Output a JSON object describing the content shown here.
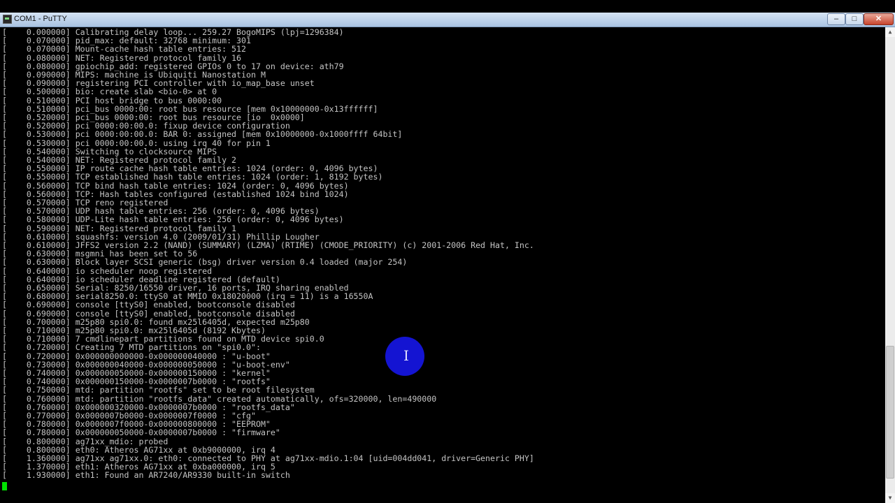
{
  "window": {
    "title": "COM1 - PuTTY",
    "buttons": {
      "minimize": "–",
      "maximize": "□",
      "close": "✕"
    },
    "icon": "putty-terminal-icon"
  },
  "terminal": {
    "lines": [
      "[    0.000000] Calibrating delay loop... 259.27 BogoMIPS (lpj=1296384)",
      "[    0.070000] pid_max: default: 32768 minimum: 301",
      "[    0.070000] Mount-cache hash table entries: 512",
      "[    0.080000] NET: Registered protocol family 16",
      "[    0.080000] gpiochip_add: registered GPIOs 0 to 17 on device: ath79",
      "[    0.090000] MIPS: machine is Ubiquiti Nanostation M",
      "[    0.090000] registering PCI controller with io_map_base unset",
      "[    0.500000] bio: create slab <bio-0> at 0",
      "[    0.510000] PCI host bridge to bus 0000:00",
      "[    0.510000] pci_bus 0000:00: root bus resource [mem 0x10000000-0x13ffffff]",
      "[    0.520000] pci_bus 0000:00: root bus resource [io  0x0000]",
      "[    0.520000] pci 0000:00:00.0: fixup device configuration",
      "[    0.530000] pci 0000:00:00.0: BAR 0: assigned [mem 0x10000000-0x1000ffff 64bit]",
      "[    0.530000] pci 0000:00:00.0: using irq 40 for pin 1",
      "[    0.540000] Switching to clocksource MIPS",
      "[    0.540000] NET: Registered protocol family 2",
      "[    0.550000] IP route cache hash table entries: 1024 (order: 0, 4096 bytes)",
      "[    0.550000] TCP established hash table entries: 1024 (order: 1, 8192 bytes)",
      "[    0.560000] TCP bind hash table entries: 1024 (order: 0, 4096 bytes)",
      "[    0.560000] TCP: Hash tables configured (established 1024 bind 1024)",
      "[    0.570000] TCP reno registered",
      "[    0.570000] UDP hash table entries: 256 (order: 0, 4096 bytes)",
      "[    0.580000] UDP-Lite hash table entries: 256 (order: 0, 4096 bytes)",
      "[    0.590000] NET: Registered protocol family 1",
      "[    0.610000] squashfs: version 4.0 (2009/01/31) Phillip Lougher",
      "[    0.610000] JFFS2 version 2.2 (NAND) (SUMMARY) (LZMA) (RTIME) (CMODE_PRIORITY) (c) 2001-2006 Red Hat, Inc.",
      "[    0.630000] msgmni has been set to 56",
      "[    0.630000] Block layer SCSI generic (bsg) driver version 0.4 loaded (major 254)",
      "[    0.640000] io scheduler noop registered",
      "[    0.640000] io scheduler deadline registered (default)",
      "[    0.650000] Serial: 8250/16550 driver, 16 ports, IRQ sharing enabled",
      "[    0.680000] serial8250.0: ttyS0 at MMIO 0x18020000 (irq = 11) is a 16550A",
      "[    0.690000] console [ttyS0] enabled, bootconsole disabled",
      "[    0.690000] console [ttyS0] enabled, bootconsole disabled",
      "[    0.700000] m25p80 spi0.0: found mx25l6405d, expected m25p80",
      "[    0.710000] m25p80 spi0.0: mx25l6405d (8192 Kbytes)",
      "[    0.710000] 7 cmdlinepart partitions found on MTD device spi0.0",
      "[    0.720000] Creating 7 MTD partitions on \"spi0.0\":",
      "[    0.720000] 0x000000000000-0x000000040000 : \"u-boot\"",
      "[    0.730000] 0x000000040000-0x000000050000 : \"u-boot-env\"",
      "[    0.740000] 0x000000050000-0x000000150000 : \"kernel\"",
      "[    0.740000] 0x000000150000-0x0000007b0000 : \"rootfs\"",
      "[    0.750000] mtd: partition \"rootfs\" set to be root filesystem",
      "[    0.760000] mtd: partition \"rootfs_data\" created automatically, ofs=320000, len=490000",
      "[    0.760000] 0x000000320000-0x0000007b0000 : \"rootfs_data\"",
      "[    0.770000] 0x0000007b0000-0x0000007f0000 : \"cfg\"",
      "[    0.780000] 0x0000007f0000-0x000000800000 : \"EEPROM\"",
      "[    0.780000] 0x000000050000-0x0000007b0000 : \"firmware\"",
      "[    0.800000] ag71xx_mdio: probed",
      "[    0.800000] eth0: Atheros AG71xx at 0xb9000000, irq 4",
      "[    1.360000] ag71xx ag71xx.0: eth0: connected to PHY at ag71xx-mdio.1:04 [uid=004dd041, driver=Generic PHY]",
      "[    1.370000] eth1: Atheros AG71xx at 0xba000000, irq 5",
      "[    1.930000] eth1: Found an AR7240/AR9330 built-in switch"
    ]
  },
  "colors": {
    "terminal_bg": "#000000",
    "terminal_fg": "#c4c4c4",
    "cursor": "#00e000",
    "pointer_highlight": "#1414d2"
  }
}
